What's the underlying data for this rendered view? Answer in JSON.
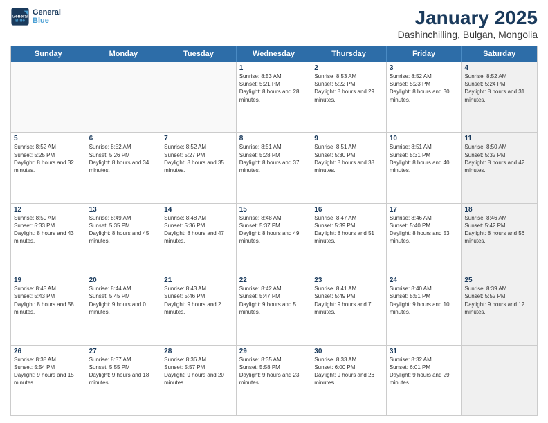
{
  "header": {
    "logo_line1": "General",
    "logo_line2": "Blue",
    "title": "January 2025",
    "subtitle": "Dashinchilling, Bulgan, Mongolia"
  },
  "calendar": {
    "days_of_week": [
      "Sunday",
      "Monday",
      "Tuesday",
      "Wednesday",
      "Thursday",
      "Friday",
      "Saturday"
    ],
    "weeks": [
      [
        {
          "day": "",
          "empty": true
        },
        {
          "day": "",
          "empty": true
        },
        {
          "day": "",
          "empty": true
        },
        {
          "day": "1",
          "sunrise": "8:53 AM",
          "sunset": "5:21 PM",
          "daylight": "8 hours and 28 minutes."
        },
        {
          "day": "2",
          "sunrise": "8:53 AM",
          "sunset": "5:22 PM",
          "daylight": "8 hours and 29 minutes."
        },
        {
          "day": "3",
          "sunrise": "8:52 AM",
          "sunset": "5:23 PM",
          "daylight": "8 hours and 30 minutes."
        },
        {
          "day": "4",
          "sunrise": "8:52 AM",
          "sunset": "5:24 PM",
          "daylight": "8 hours and 31 minutes.",
          "shaded": true
        }
      ],
      [
        {
          "day": "5",
          "sunrise": "8:52 AM",
          "sunset": "5:25 PM",
          "daylight": "8 hours and 32 minutes."
        },
        {
          "day": "6",
          "sunrise": "8:52 AM",
          "sunset": "5:26 PM",
          "daylight": "8 hours and 34 minutes."
        },
        {
          "day": "7",
          "sunrise": "8:52 AM",
          "sunset": "5:27 PM",
          "daylight": "8 hours and 35 minutes."
        },
        {
          "day": "8",
          "sunrise": "8:51 AM",
          "sunset": "5:28 PM",
          "daylight": "8 hours and 37 minutes."
        },
        {
          "day": "9",
          "sunrise": "8:51 AM",
          "sunset": "5:30 PM",
          "daylight": "8 hours and 38 minutes."
        },
        {
          "day": "10",
          "sunrise": "8:51 AM",
          "sunset": "5:31 PM",
          "daylight": "8 hours and 40 minutes."
        },
        {
          "day": "11",
          "sunrise": "8:50 AM",
          "sunset": "5:32 PM",
          "daylight": "8 hours and 42 minutes.",
          "shaded": true
        }
      ],
      [
        {
          "day": "12",
          "sunrise": "8:50 AM",
          "sunset": "5:33 PM",
          "daylight": "8 hours and 43 minutes."
        },
        {
          "day": "13",
          "sunrise": "8:49 AM",
          "sunset": "5:35 PM",
          "daylight": "8 hours and 45 minutes."
        },
        {
          "day": "14",
          "sunrise": "8:48 AM",
          "sunset": "5:36 PM",
          "daylight": "8 hours and 47 minutes."
        },
        {
          "day": "15",
          "sunrise": "8:48 AM",
          "sunset": "5:37 PM",
          "daylight": "8 hours and 49 minutes."
        },
        {
          "day": "16",
          "sunrise": "8:47 AM",
          "sunset": "5:39 PM",
          "daylight": "8 hours and 51 minutes."
        },
        {
          "day": "17",
          "sunrise": "8:46 AM",
          "sunset": "5:40 PM",
          "daylight": "8 hours and 53 minutes."
        },
        {
          "day": "18",
          "sunrise": "8:46 AM",
          "sunset": "5:42 PM",
          "daylight": "8 hours and 56 minutes.",
          "shaded": true
        }
      ],
      [
        {
          "day": "19",
          "sunrise": "8:45 AM",
          "sunset": "5:43 PM",
          "daylight": "8 hours and 58 minutes."
        },
        {
          "day": "20",
          "sunrise": "8:44 AM",
          "sunset": "5:45 PM",
          "daylight": "9 hours and 0 minutes."
        },
        {
          "day": "21",
          "sunrise": "8:43 AM",
          "sunset": "5:46 PM",
          "daylight": "9 hours and 2 minutes."
        },
        {
          "day": "22",
          "sunrise": "8:42 AM",
          "sunset": "5:47 PM",
          "daylight": "9 hours and 5 minutes."
        },
        {
          "day": "23",
          "sunrise": "8:41 AM",
          "sunset": "5:49 PM",
          "daylight": "9 hours and 7 minutes."
        },
        {
          "day": "24",
          "sunrise": "8:40 AM",
          "sunset": "5:51 PM",
          "daylight": "9 hours and 10 minutes."
        },
        {
          "day": "25",
          "sunrise": "8:39 AM",
          "sunset": "5:52 PM",
          "daylight": "9 hours and 12 minutes.",
          "shaded": true
        }
      ],
      [
        {
          "day": "26",
          "sunrise": "8:38 AM",
          "sunset": "5:54 PM",
          "daylight": "9 hours and 15 minutes."
        },
        {
          "day": "27",
          "sunrise": "8:37 AM",
          "sunset": "5:55 PM",
          "daylight": "9 hours and 18 minutes."
        },
        {
          "day": "28",
          "sunrise": "8:36 AM",
          "sunset": "5:57 PM",
          "daylight": "9 hours and 20 minutes."
        },
        {
          "day": "29",
          "sunrise": "8:35 AM",
          "sunset": "5:58 PM",
          "daylight": "9 hours and 23 minutes."
        },
        {
          "day": "30",
          "sunrise": "8:33 AM",
          "sunset": "6:00 PM",
          "daylight": "9 hours and 26 minutes."
        },
        {
          "day": "31",
          "sunrise": "8:32 AM",
          "sunset": "6:01 PM",
          "daylight": "9 hours and 29 minutes."
        },
        {
          "day": "",
          "empty": true,
          "shaded": true
        }
      ]
    ]
  }
}
